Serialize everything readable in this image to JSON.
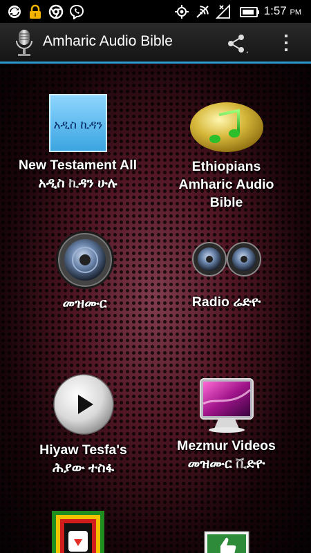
{
  "status_bar": {
    "time": "1:57",
    "ampm": "PM",
    "left_icons": [
      "sync-icon",
      "lock-icon",
      "chrome-icon",
      "viber-icon"
    ],
    "right_icons": [
      "gps-icon",
      "no-signal-icon",
      "wifi-off-icon",
      "battery-icon"
    ]
  },
  "action_bar": {
    "title": "Amharic Audio Bible",
    "accent_color": "#2b9bd3",
    "icons": [
      "microphone-icon",
      "share-icon",
      "overflow-menu-icon"
    ]
  },
  "tiles": [
    {
      "line1": "New Testament All",
      "line2": "አዲስ ኪዳን ሁሉ",
      "icon_text": "አዲስ ኪዳን",
      "icon": "book-icon"
    },
    {
      "line1": "Ethiopians",
      "line2": "Amharic Audio",
      "line3": "Bible",
      "icon": "music-note-icon"
    },
    {
      "line1": "መዝሙር",
      "icon": "speaker-icon"
    },
    {
      "line1": "Radio ሬድዮ",
      "icon": "speakers-icon"
    },
    {
      "line1": "Hiyaw Tesfa's",
      "line2": "ሕያው ተስፋ",
      "icon": "play-icon"
    },
    {
      "line1": "Mezmur Videos",
      "line2": "መዝሙር ቪድዮ",
      "icon": "video-monitor-icon"
    },
    {
      "icon": "youtube-icon"
    },
    {
      "icon": "thumbs-up-icon"
    }
  ]
}
